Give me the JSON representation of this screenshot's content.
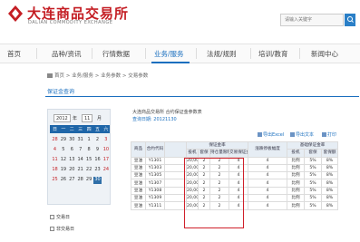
{
  "header": {
    "logo_cn": "大连商品交易所",
    "logo_en": "DALIAN COMMODITY EXCHANGE",
    "search_placeholder": "请输入关键字"
  },
  "nav": {
    "items": [
      "首页",
      "品种/资讯",
      "行情数据",
      "业务/服务",
      "法规/规则",
      "培训/教育",
      "新闻中心"
    ],
    "active": "业务/服务"
  },
  "breadcrumb": [
    "首页",
    "业务/服务",
    "业务参数",
    "交易参数"
  ],
  "subtab": "保证金查询",
  "calendar": {
    "year": "2012",
    "month": "11",
    "year_suffix": "年",
    "month_suffix": "月",
    "weekdays": [
      "日",
      "一",
      "二",
      "三",
      "四",
      "五",
      "六"
    ],
    "today": "30",
    "rows": [
      [
        "28",
        "29",
        "30",
        "31",
        "1",
        "2",
        "3"
      ],
      [
        "4",
        "5",
        "6",
        "7",
        "8",
        "9",
        "10"
      ],
      [
        "11",
        "12",
        "13",
        "14",
        "15",
        "16",
        "17"
      ],
      [
        "18",
        "19",
        "20",
        "21",
        "22",
        "23",
        "24"
      ],
      [
        "25",
        "26",
        "27",
        "28",
        "29",
        "30",
        ""
      ]
    ]
  },
  "legend": {
    "trading_day": "交易日",
    "holiday": "非交易日"
  },
  "report": {
    "title": "大连商品交易所 合约保证金参数表",
    "date": "查询日期: 20121130",
    "tools": [
      "导出Excel",
      "导出文本",
      "打印"
    ],
    "group_headers": {
      "margin": "保证金率",
      "limit": "涨跌停板幅度",
      "base": "基础保证金率"
    },
    "columns": [
      "商品",
      "合约代码",
      "投机",
      "套保",
      "持仓量限制",
      "交易保证金",
      "涨跌停板",
      "投机",
      "套保",
      "套保额"
    ],
    "rows": [
      [
        "豆油",
        "Y1301",
        "20,000",
        "2",
        "2",
        "4",
        "4",
        "比例",
        "5%",
        "8%"
      ],
      [
        "豆油",
        "Y1303",
        "20,000",
        "2",
        "2",
        "4",
        "4",
        "比例",
        "5%",
        "8%"
      ],
      [
        "豆油",
        "Y1305",
        "20,000",
        "2",
        "2",
        "4",
        "4",
        "比例",
        "5%",
        "8%"
      ],
      [
        "豆油",
        "Y1307",
        "20,000",
        "2",
        "2",
        "4",
        "4",
        "比例",
        "5%",
        "8%"
      ],
      [
        "豆油",
        "Y1308",
        "20,000",
        "2",
        "2",
        "4",
        "4",
        "比例",
        "5%",
        "8%"
      ],
      [
        "豆油",
        "Y1309",
        "20,000",
        "2",
        "2",
        "4",
        "4",
        "比例",
        "5%",
        "8%"
      ],
      [
        "豆油",
        "Y1311",
        "20,000",
        "2",
        "2",
        "4",
        "4",
        "比例",
        "5%",
        "8%"
      ]
    ]
  }
}
